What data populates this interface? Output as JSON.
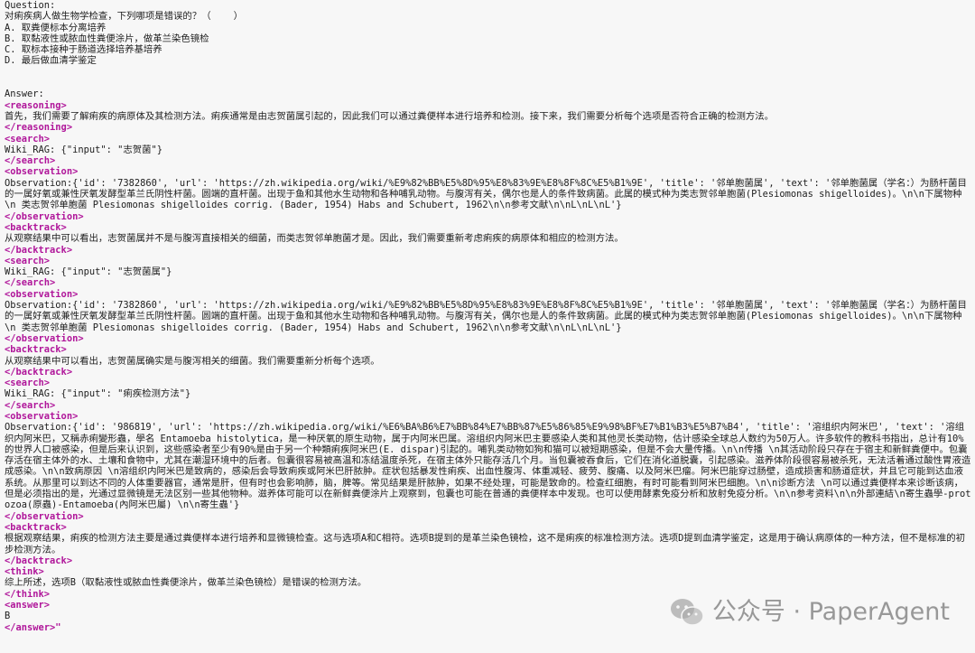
{
  "question": {
    "label": "Question:",
    "text": "对痢疾病人做生物学检查，下列哪项是错误的？（    ）",
    "options": [
      "A. 取粪便标本分离培养",
      "B. 取黏液性或脓血性粪便涂片，做革兰染色镜检",
      "C. 取标本接种于肠道选择培养基培养",
      "D. 最后做血清学鉴定"
    ]
  },
  "answer_label": "Answer:",
  "tags": {
    "reasoning_open": "<reasoning>",
    "reasoning_close": "</reasoning>",
    "search_open": "<search>",
    "search_close": "</search>",
    "observation_open": "<observation>",
    "observation_close": "</observation>",
    "backtrack_open": "<backtrack>",
    "backtrack_close": "</backtrack>",
    "think_open": "<think>",
    "think_close": "</think>",
    "answer_open": "<answer>",
    "answer_close": "</answer>\""
  },
  "reasoning": "首先，我们需要了解痢疾的病原体及其检测方法。痢疾通常是由志贺菌属引起的，因此我们可以通过粪便样本进行培养和检测。接下来，我们需要分析每个选项是否符合正确的检测方法。",
  "steps": [
    {
      "search": "Wiki_RAG: {\"input\": \"志贺菌\"}",
      "observation": "Observation:{'id': '7382860', 'url': 'https://zh.wikipedia.org/wiki/%E9%82%BB%E5%8D%95%E8%83%9E%E8%8F%8C%E5%B1%9E', 'title': '邻单胞菌属', 'text': '邻单胞菌属（学名：）为肠杆菌目的一属好氧或兼性厌氧发酵型革兰氏阴性杆菌。圆端的直杆菌。出现于鱼和其他水生动物和各种哺乳动物。与腹泻有关，偶尔也是人的条件致病菌。此属的模式种为类志贺邻单胞菌(Plesiomonas shigelloides)。\\n\\n下属物种\\n 类志贺邻单胞菌 Plesiomonas shigelloides corrig. (Bader, 1954) Habs and Schubert, 1962\\n\\n参考文献\\n\\nL\\nL\\nL'}",
      "backtrack": "从观察结果中可以看出，志贺菌属并不是与腹泻直接相关的细菌，而类志贺邻单胞菌才是。因此，我们需要重新考虑痢疾的病原体和相应的检测方法。"
    },
    {
      "search": "Wiki_RAG: {\"input\": \"志贺菌属\"}",
      "observation": "Observation:{'id': '7382860', 'url': 'https://zh.wikipedia.org/wiki/%E9%82%BB%E5%8D%95%E8%83%9E%E8%8F%8C%E5%B1%9E', 'title': '邻单胞菌属', 'text': '邻单胞菌属（学名：）为肠杆菌目的一属好氧或兼性厌氧发酵型革兰氏阴性杆菌。圆端的直杆菌。出现于鱼和其他水生动物和各种哺乳动物。与腹泻有关，偶尔也是人的条件致病菌。此属的模式种为类志贺邻单胞菌(Plesiomonas shigelloides)。\\n\\n下属物种\\n 类志贺邻单胞菌 Plesiomonas shigelloides corrig. (Bader, 1954) Habs and Schubert, 1962\\n\\n参考文献\\n\\nL\\nL\\nL'}",
      "backtrack": "从观察结果中可以看出，志贺菌属确实是与腹泻相关的细菌。我们需要重新分析每个选项。"
    },
    {
      "search": "Wiki_RAG: {\"input\": \"痢疾检测方法\"}",
      "observation": "Observation:{'id': '986819', 'url': 'https://zh.wikipedia.org/wiki/%E6%BA%B6%E7%BB%84%E7%BB%87%E5%86%85%E9%98%BF%E7%B1%B3%E5%B7%B4', 'title': '溶组织内阿米巴', 'text': '溶组织内阿米巴，又稱赤痢變形蟲，學名 Entamoeba histolytica，是一种厌氧的原生动物，属于内阿米巴属。溶组织内阿米巴主要感染人类和其他灵长类动物，估计感染全球总人数约为50万人。许多软件的教科书指出，总计有10%的世界人口被感染，但是后来认识到，这些感染者至少有90%是由于另一个种類痢疾阿米巴(E. dispar)引起的。哺乳类动物如狗和猫可以被短期感染，但是不会大量传播。\\n\\n传播 \\n其活动阶段只存在于宿主和新鲜粪便中。包囊存活在宿主体外的水、土壤和食物中，尤其在潮湿环境中的后者。包囊很容易被高温和冻结温度杀死，在宿主体外只能存活几个月。当包囊被吞食后，它们在消化道脱囊，引起感染。滋养体阶段很容易被杀死，无法活着通过酸性胃液造成感染。\\n\\n致病原因 \\n溶组织内阿米巴是致病的，感染后会导致痢疾或阿米巴肝脓肿。症状包括暴发性痢疾、出血性腹泻、体重减轻、疲劳、腹痛、以及阿米巴瘤。阿米巴能穿过肠壁，造成损害和肠道症状，并且它可能到达血液系统。从那里可以到达不同的人体重要器官，通常是肝，但有时也会影响肺，脑，脾等。常见结果是肝脓肿，如果不经处理，可能是致命的。检查红细胞，有时可能看到阿米巴细胞。\\n\\n诊断方法 \\n可以通过粪便样本来诊断该病，但是必须指出的是，光通过显微镜是无法区别一些其他物种。滋养体可能可以在新鲜粪便涂片上观察到，包囊也可能在普通的粪便样本中发现。也可以使用酵素免疫分析和放射免疫分析。\\n\\n参考资料\\n\\n外部連結\\n寄生蟲學-protozoa(原蟲)-Entamoeba(內阿米巴屬) \\n\\n寄生蟲'}",
      "backtrack": "根据观察结果，痢疾的检测方法主要是通过粪便样本进行培养和显微镜检查。这与选项A和C相符。选项B提到的是革兰染色镜检，这不是痢疾的标准检测方法。选项D提到血清学鉴定，这是用于确认病原体的一种方法，但不是标准的初步检测方法。"
    }
  ],
  "think": "综上所述，选项B（取黏液性或脓血性粪便涂片，做革兰染色镜检）是错误的检测方法。",
  "answer": "B",
  "watermark": "公众号 · PaperAgent"
}
